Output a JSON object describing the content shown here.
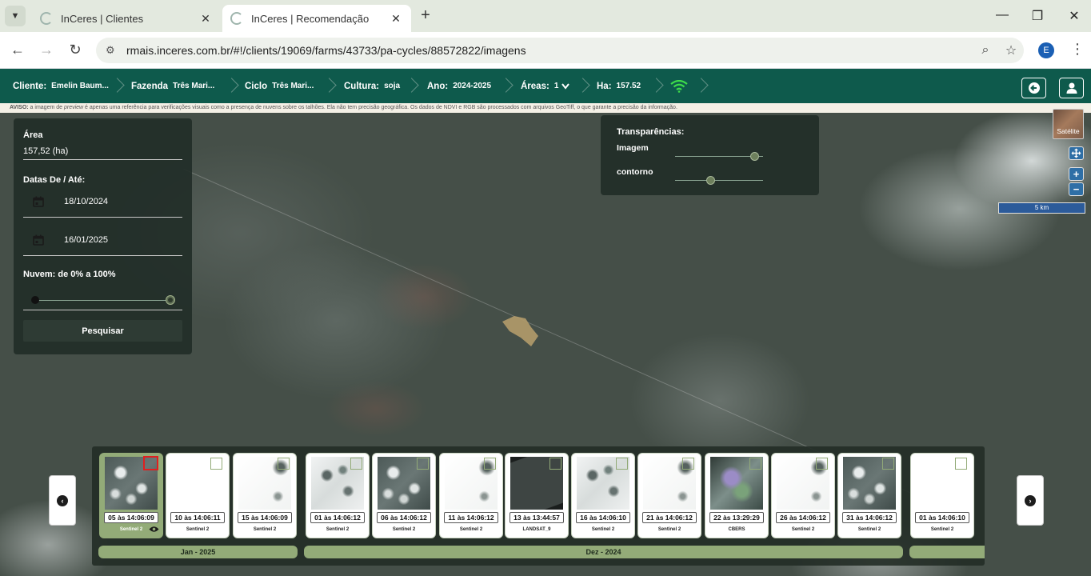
{
  "browser": {
    "tabs": [
      {
        "title": "InCeres | Clientes",
        "active": false
      },
      {
        "title": "InCeres | Recomendação",
        "active": true
      }
    ],
    "url": "rmais.inceres.com.br/#!/clients/19069/farms/43733/pa-cycles/88572822/imagens",
    "profile_initial": "E"
  },
  "header": {
    "cliente": {
      "label": "Cliente:",
      "value": "Emelin Baum..."
    },
    "fazenda": {
      "label": "Fazenda",
      "value": "Três Mari..."
    },
    "ciclo": {
      "label": "Ciclo",
      "value": "Três Mari..."
    },
    "cultura": {
      "label": "Cultura:",
      "value": "soja"
    },
    "ano": {
      "label": "Ano:",
      "value": "2024-2025"
    },
    "areas": {
      "label": "Áreas:",
      "value": "1"
    },
    "ha": {
      "label": "Ha:",
      "value": "157.52"
    }
  },
  "notice": {
    "prefix": "AVISO:",
    "text_1": " a imagem de ",
    "italic": "preview",
    "text_2": " é apenas uma referência para verificações visuais como a presença de nuvens sobre os talhões. Ela não tem precisão geográfica. Os dados de NDVI e RGB são processados com arquivos GeoTiff, o que garante a precisão da informação."
  },
  "filters": {
    "area_label": "Área",
    "area_value": "157,52 (ha)",
    "dates_label": "Datas De / Até:",
    "date_from": "18/10/2024",
    "date_to": "16/01/2025",
    "cloud_label": "Nuvem: de 0% a 100%",
    "cloud_min": 0,
    "cloud_max": 100,
    "search_button": "Pesquisar"
  },
  "transparency": {
    "title": "Transparências:",
    "image_label": "Imagem",
    "image_value": 0.9,
    "contour_label": "contorno",
    "contour_value": 0.4
  },
  "map_controls": {
    "satellite_label": "Satélite",
    "zoom_in": "+",
    "zoom_out": "−",
    "scale_label": "5 km"
  },
  "images": [
    {
      "date": "05 às 14:06:09",
      "sensor": "Sentinel 2",
      "selected": true,
      "style": "cloudy-dark"
    },
    {
      "date": "10 às 14:06:11",
      "sensor": "Sentinel 2",
      "selected": false,
      "style": "white"
    },
    {
      "date": "15 às 14:06:09",
      "sensor": "Sentinel 2",
      "selected": false,
      "style": "mostly-white"
    },
    {
      "date": "01 às 14:06:12",
      "sensor": "Sentinel 2",
      "selected": false,
      "style": "cloudy-light"
    },
    {
      "date": "06 às 14:06:12",
      "sensor": "Sentinel 2",
      "selected": false,
      "style": "cloudy-dark"
    },
    {
      "date": "11 às 14:06:12",
      "sensor": "Sentinel 2",
      "selected": false,
      "style": "mostly-white"
    },
    {
      "date": "13 às 13:44:57",
      "sensor": "LANDSAT_9",
      "selected": false,
      "style": "landsat"
    },
    {
      "date": "16 às 14:06:10",
      "sensor": "Sentinel 2",
      "selected": false,
      "style": "cloudy-light"
    },
    {
      "date": "21 às 14:06:12",
      "sensor": "Sentinel 2",
      "selected": false,
      "style": "mostly-white"
    },
    {
      "date": "22 às 13:29:29",
      "sensor": "CBERS",
      "selected": false,
      "style": "cbers"
    },
    {
      "date": "26 às 14:06:12",
      "sensor": "Sentinel 2",
      "selected": false,
      "style": "mostly-white"
    },
    {
      "date": "31 às 14:06:12",
      "sensor": "Sentinel 2",
      "selected": false,
      "style": "cloudy-dark"
    },
    {
      "date": "01 às 14:06:10",
      "sensor": "Sentinel 2",
      "selected": false,
      "style": "white"
    }
  ],
  "months": [
    {
      "label": "Jan - 2025"
    },
    {
      "label": "Dez - 2024"
    },
    {
      "label": ""
    }
  ],
  "colors": {
    "header_bg": "#0e5a4c",
    "accent_green": "#93ab78",
    "wifi_green": "#3ddc4a",
    "selected_border": "#e02020"
  }
}
